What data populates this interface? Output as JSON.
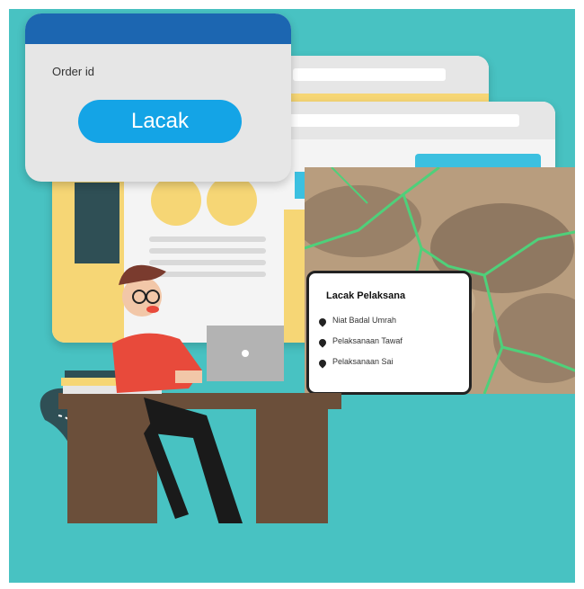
{
  "order_card": {
    "label": "Order id",
    "button_label": "Lacak"
  },
  "tracker": {
    "title": "Lacak Pelaksana",
    "items": [
      {
        "label": "Niat Badal Umrah"
      },
      {
        "label": "Pelaksanaan Tawaf"
      },
      {
        "label": "Pelaksanaan Sai"
      }
    ]
  },
  "colors": {
    "background": "#48c2c2",
    "header_blue": "#1c66b1",
    "button_blue": "#14a4e6",
    "accent_yellow": "#f6d675",
    "road_green": "#4fd07a"
  },
  "icons": [
    "map-pin-icon",
    "laptop-icon"
  ]
}
